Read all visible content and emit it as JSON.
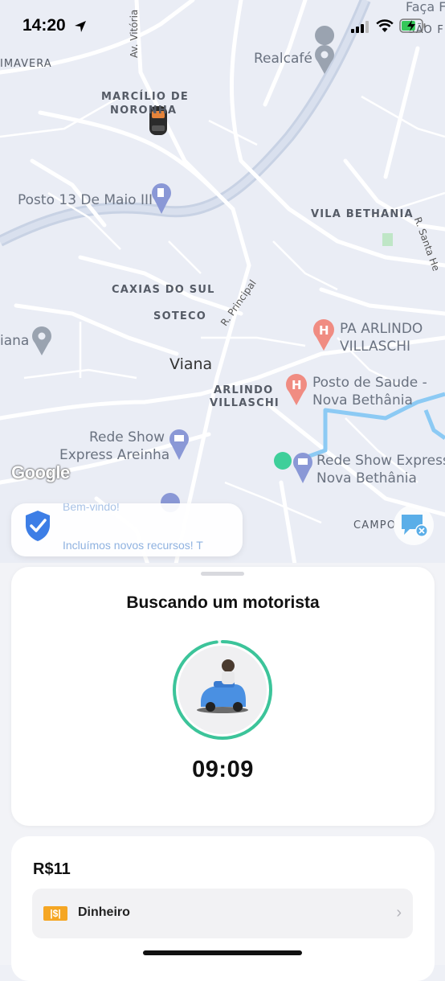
{
  "status_bar": {
    "time": "14:20",
    "battery_level": 0.7
  },
  "map": {
    "labels": {
      "primavera": "IMAVERA",
      "marcilio_1": "MARCÍLIO DE",
      "marcilio_2": "NORONHA",
      "av_vitoria": "Av. Vitória",
      "realcafe": "Realcafé",
      "faca_fit": "Faça F",
      "sao": "SÃO F",
      "posto13": "Posto 13 De Maio III",
      "vila_bethania": "VILA BETHANIA",
      "r_santa": "R. Santa He",
      "caxias": "CAXIAS DO SUL",
      "soteco": "SOTECO",
      "r_principal": "R. Principal",
      "pa_arlindo_1": "PA ARLINDO",
      "pa_arlindo_2": "VILLASCHI",
      "viana_left": "iana",
      "viana": "Viana",
      "arlindo_1": "ARLINDO",
      "arlindo_2": "VILLASCHI",
      "posto_saude_1": "Posto de Saude -",
      "posto_saude_2": "Nova Bethânia",
      "rede_areinha_1": "Rede Show",
      "rede_areinha_2": "Express Areinha",
      "rede_nova_1": "Rede Show Express",
      "rede_nova_2": "Nova Bethânia",
      "campo": "CAMPO"
    },
    "colors": {
      "route": "#8ccaf4",
      "origin": "#3ecf9a",
      "road": "#ffffff",
      "highway": "#c8d2e4"
    }
  },
  "google_logo": "Google",
  "notice": {
    "title": "Bem-vindo!",
    "text": "Incluímos novos recursos! T"
  },
  "search": {
    "title": "Buscando um motorista",
    "timer": "09:09",
    "progress": 0.98,
    "accent": "#3cc49a"
  },
  "payment": {
    "price": "R$11",
    "method": "Dinheiro",
    "method_icon": "cash-icon"
  }
}
